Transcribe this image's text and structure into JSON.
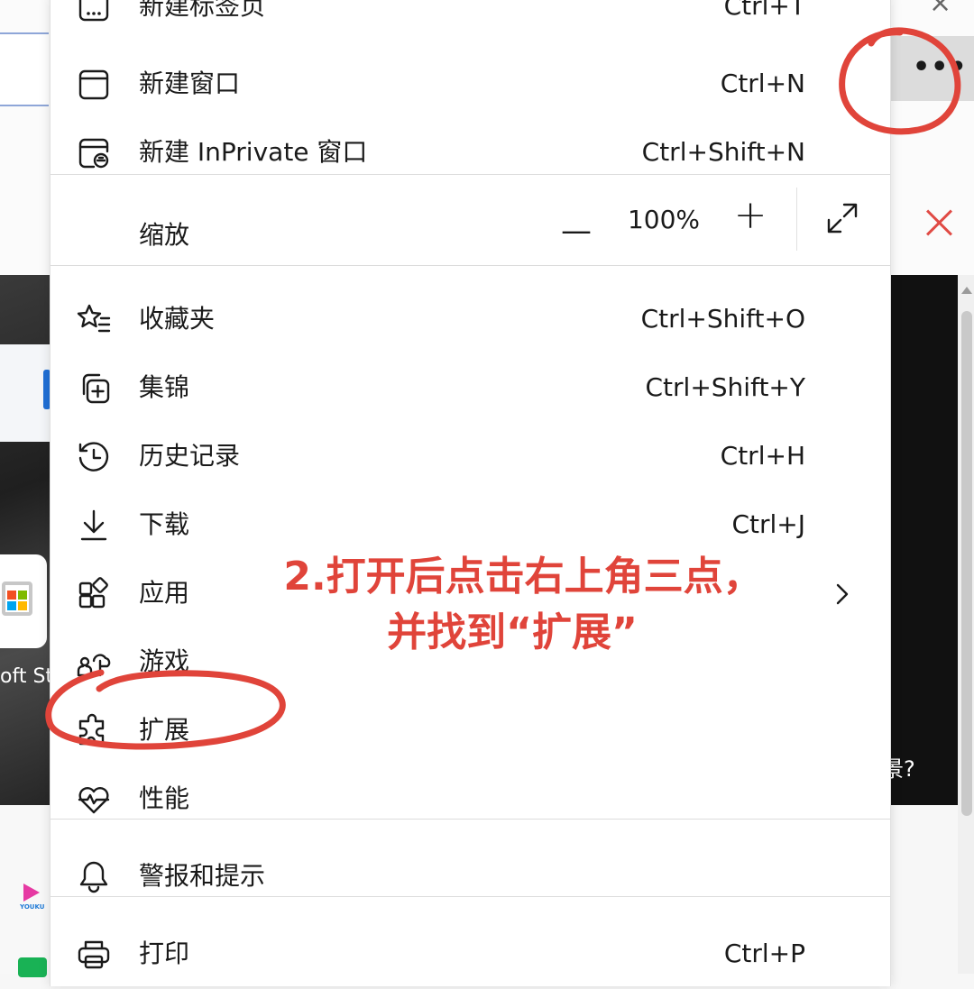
{
  "menu": {
    "items": [
      {
        "label": "新建标签页",
        "shortcut": "Ctrl+T",
        "icon": "new-tab-icon"
      },
      {
        "label": "新建窗口",
        "shortcut": "Ctrl+N",
        "icon": "new-window-icon"
      },
      {
        "label": "新建 InPrivate 窗口",
        "shortcut": "Ctrl+Shift+N",
        "icon": "inprivate-icon"
      },
      {
        "label": "收藏夹",
        "shortcut": "Ctrl+Shift+O",
        "icon": "favorites-icon"
      },
      {
        "label": "集锦",
        "shortcut": "Ctrl+Shift+Y",
        "icon": "collections-icon"
      },
      {
        "label": "历史记录",
        "shortcut": "Ctrl+H",
        "icon": "history-icon"
      },
      {
        "label": "下载",
        "shortcut": "Ctrl+J",
        "icon": "download-icon"
      },
      {
        "label": "应用",
        "shortcut": "",
        "icon": "apps-icon"
      },
      {
        "label": "游戏",
        "shortcut": "",
        "icon": "games-icon"
      },
      {
        "label": "扩展",
        "shortcut": "",
        "icon": "extensions-icon"
      },
      {
        "label": "性能",
        "shortcut": "",
        "icon": "performance-icon"
      },
      {
        "label": "警报和提示",
        "shortcut": "",
        "icon": "bell-icon"
      },
      {
        "label": "打印",
        "shortcut": "Ctrl+P",
        "icon": "print-icon"
      }
    ],
    "zoom": {
      "label": "缩放",
      "value": "100%",
      "minus": "—",
      "plus": "+"
    }
  },
  "annotation": {
    "line1": "2.打开后点击右上角三点，",
    "line2": "并找到“扩展”",
    "color": "#e0443a"
  },
  "background": {
    "store_label": "oft St",
    "partial_text": "景?",
    "youku_label": "YOUKU",
    "more_button": "•••",
    "close_glyph": "×"
  }
}
